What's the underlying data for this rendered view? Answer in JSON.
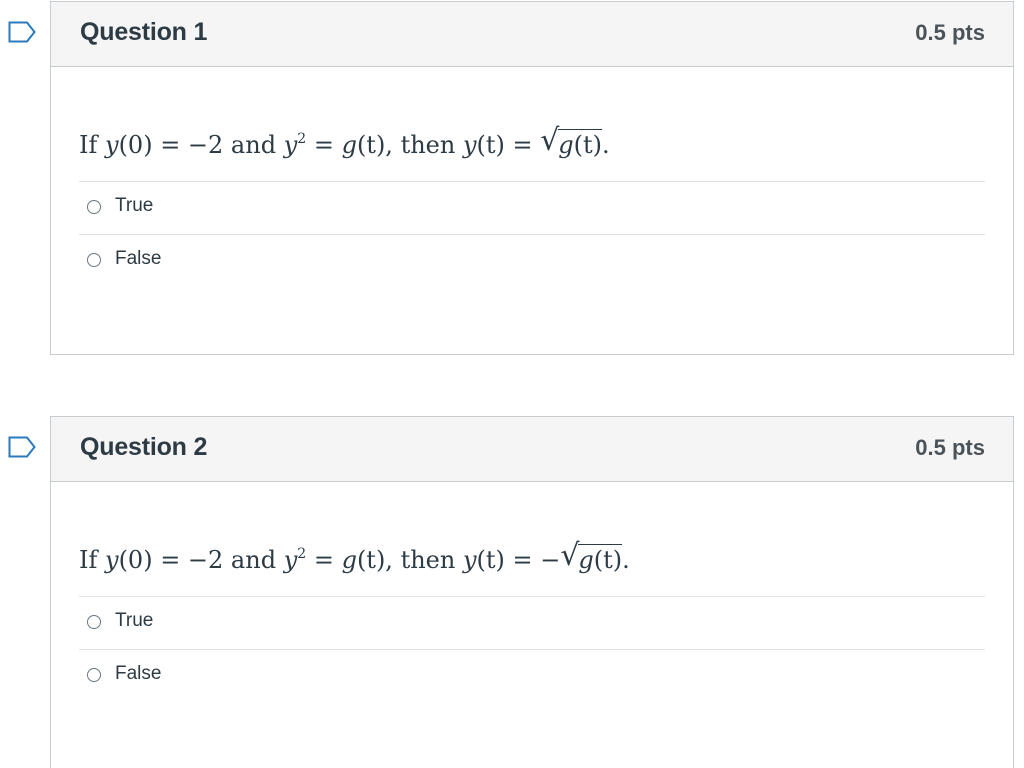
{
  "questions": [
    {
      "title": "Question 1",
      "points": "0.5 pts",
      "text": {
        "prefix": "If ",
        "y0": "y",
        "y0_rest": "(0) = −2 and ",
        "ysq": "y",
        "exp": "2",
        "mid": " = ",
        "g": "g",
        "gt": "(t), then ",
        "yt": "y",
        "yt_rest": "(t) = ",
        "neg": "",
        "rad_g": "g",
        "rad_t": "(t)",
        "end": "."
      },
      "answers": [
        {
          "label": "True"
        },
        {
          "label": "False"
        }
      ]
    },
    {
      "title": "Question 2",
      "points": "0.5 pts",
      "text": {
        "prefix": "If ",
        "y0": "y",
        "y0_rest": "(0) = −2 and ",
        "ysq": "y",
        "exp": "2",
        "mid": " = ",
        "g": "g",
        "gt": "(t), then ",
        "yt": "y",
        "yt_rest": "(t) = ",
        "neg": "−",
        "rad_g": "g",
        "rad_t": "(t)",
        "end": "."
      },
      "answers": [
        {
          "label": "True"
        },
        {
          "label": "False"
        }
      ]
    }
  ],
  "icons": {
    "flag": "flag-bookmark-icon",
    "radio": "radio-button"
  },
  "colors": {
    "flag": "#2b7abc",
    "header_bg": "#f5f5f5",
    "border": "#c7cdd1",
    "text": "#2d3b45"
  }
}
